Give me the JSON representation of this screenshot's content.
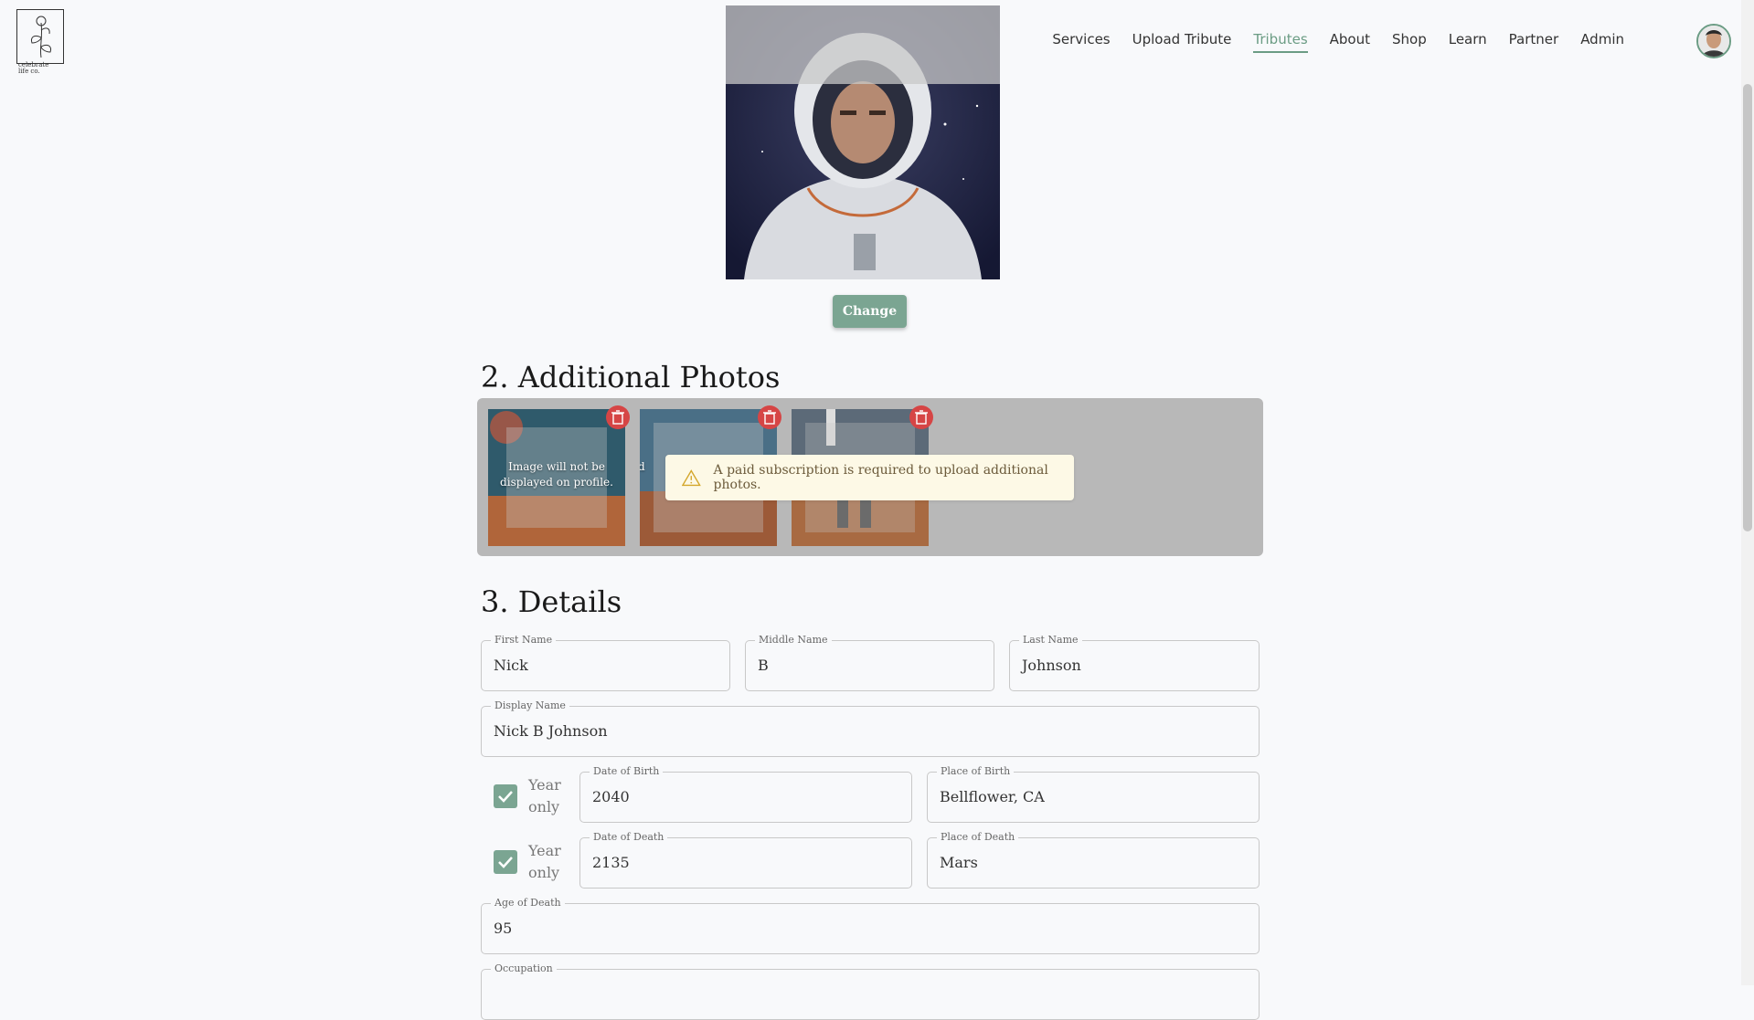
{
  "brand": {
    "logo_text_1": "celebrate",
    "logo_text_2": "life co."
  },
  "nav": {
    "items": [
      {
        "label": "Services"
      },
      {
        "label": "Upload Tribute"
      },
      {
        "label": "Tributes",
        "active": true
      },
      {
        "label": "About"
      },
      {
        "label": "Shop"
      },
      {
        "label": "Learn"
      },
      {
        "label": "Partner"
      },
      {
        "label": "Admin"
      }
    ]
  },
  "photo": {
    "change_label": "Change"
  },
  "additional": {
    "heading": "2. Additional Photos",
    "thumb_caption": "Image will not be displayed on profile.",
    "thumb_caption_partial": "d",
    "alert": "A paid subscription is required to upload additional photos."
  },
  "details": {
    "heading": "3. Details",
    "first_name": {
      "label": "First Name",
      "value": "Nick"
    },
    "middle_name": {
      "label": "Middle Name",
      "value": "B"
    },
    "last_name": {
      "label": "Last Name",
      "value": "Johnson"
    },
    "display_name": {
      "label": "Display Name",
      "value": "Nick B Johnson"
    },
    "year_only_1": "Year",
    "year_only_2": "only",
    "dob": {
      "label": "Date of Birth",
      "value": "2040"
    },
    "pob": {
      "label": "Place of Birth",
      "value": "Bellflower, CA"
    },
    "dod": {
      "label": "Date of Death",
      "value": "2135"
    },
    "pod": {
      "label": "Place of Death",
      "value": "Mars"
    },
    "age": {
      "label": "Age of Death",
      "value": "95"
    },
    "occupation": {
      "label": "Occupation",
      "value": ""
    }
  },
  "colors": {
    "accent": "#7ba592",
    "danger": "#d64545",
    "alert_bg": "#fdf9e6"
  }
}
